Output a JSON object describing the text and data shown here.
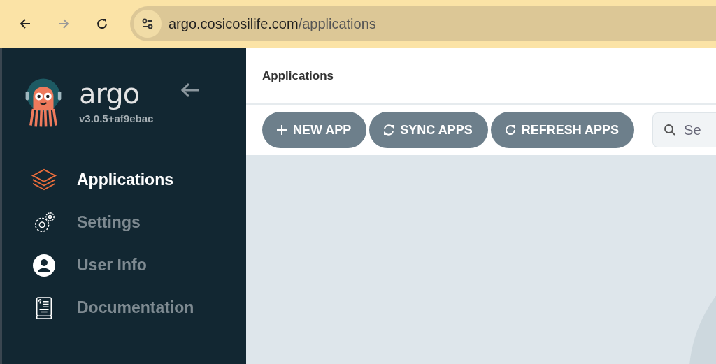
{
  "browser": {
    "url": {
      "host": "argo.cosicosilife.com",
      "path": "/applications"
    }
  },
  "sidebar": {
    "logo": {
      "name": "argo",
      "version": "v3.0.5+af9ebac"
    },
    "items": [
      {
        "label": "Applications",
        "kind": "layers",
        "selected": true
      },
      {
        "label": "Settings",
        "kind": "gears",
        "selected": false
      },
      {
        "label": "User Info",
        "kind": "user",
        "selected": false
      },
      {
        "label": "Documentation",
        "kind": "book",
        "selected": false
      }
    ]
  },
  "page": {
    "title": "Applications",
    "buttons": [
      {
        "label": "NEW APP",
        "kind": "plus"
      },
      {
        "label": "SYNC APPS",
        "kind": "sync"
      },
      {
        "label": "REFRESH APPS",
        "kind": "refresh"
      }
    ],
    "search": {
      "placeholder": "Se"
    }
  }
}
